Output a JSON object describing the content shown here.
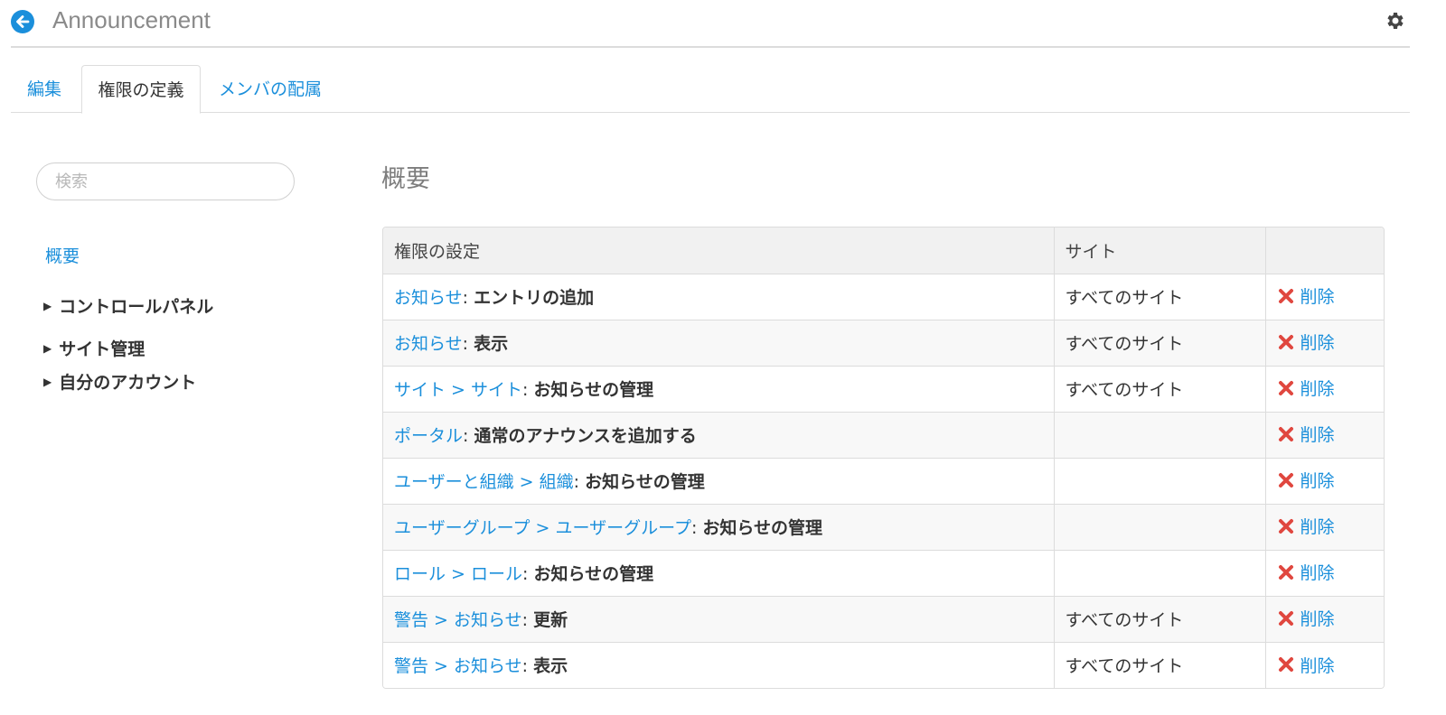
{
  "header": {
    "title": "Announcement",
    "back_icon": "back-arrow-icon",
    "settings_icon": "gear-icon"
  },
  "tabs": [
    {
      "label": "編集",
      "active": false
    },
    {
      "label": "権限の定義",
      "active": true
    },
    {
      "label": "メンバの配属",
      "active": false
    }
  ],
  "search": {
    "placeholder": "検索",
    "value": ""
  },
  "sidebar": {
    "summary_label": "概要",
    "items": [
      {
        "label": "コントロールパネル",
        "expanded": false
      },
      {
        "label": "サイト管理",
        "expanded": false
      },
      {
        "label": "自分のアカウント",
        "expanded": false
      }
    ]
  },
  "main": {
    "section_title": "概要",
    "table": {
      "columns": [
        "権限の設定",
        "サイト",
        ""
      ],
      "rows": [
        {
          "path": "お知らせ",
          "action": "エントリの追加",
          "site": "すべてのサイト",
          "delete_label": "削除"
        },
        {
          "path": "お知らせ",
          "action": "表示",
          "site": "すべてのサイト",
          "delete_label": "削除"
        },
        {
          "path": "サイト > サイト",
          "action": "お知らせの管理",
          "site": "すべてのサイト",
          "delete_label": "削除"
        },
        {
          "path": "ポータル",
          "action": "通常のアナウンスを追加する",
          "site": "",
          "delete_label": "削除"
        },
        {
          "path": "ユーザーと組織 > 組織",
          "action": "お知らせの管理",
          "site": "",
          "delete_label": "削除"
        },
        {
          "path": "ユーザーグループ > ユーザーグループ",
          "action": "お知らせの管理",
          "site": "",
          "delete_label": "削除"
        },
        {
          "path": "ロール > ロール",
          "action": "お知らせの管理",
          "site": "",
          "delete_label": "削除"
        },
        {
          "path": "警告 > お知らせ",
          "action": "更新",
          "site": "すべてのサイト",
          "delete_label": "削除"
        },
        {
          "path": "警告 > お知らせ",
          "action": "表示",
          "site": "すべてのサイト",
          "delete_label": "削除"
        }
      ]
    }
  },
  "colors": {
    "accent": "#1b8fdb",
    "delete_icon": "#e0473f",
    "header_rule": "#dcdcdc",
    "table_header_bg": "#f1f1f1"
  }
}
